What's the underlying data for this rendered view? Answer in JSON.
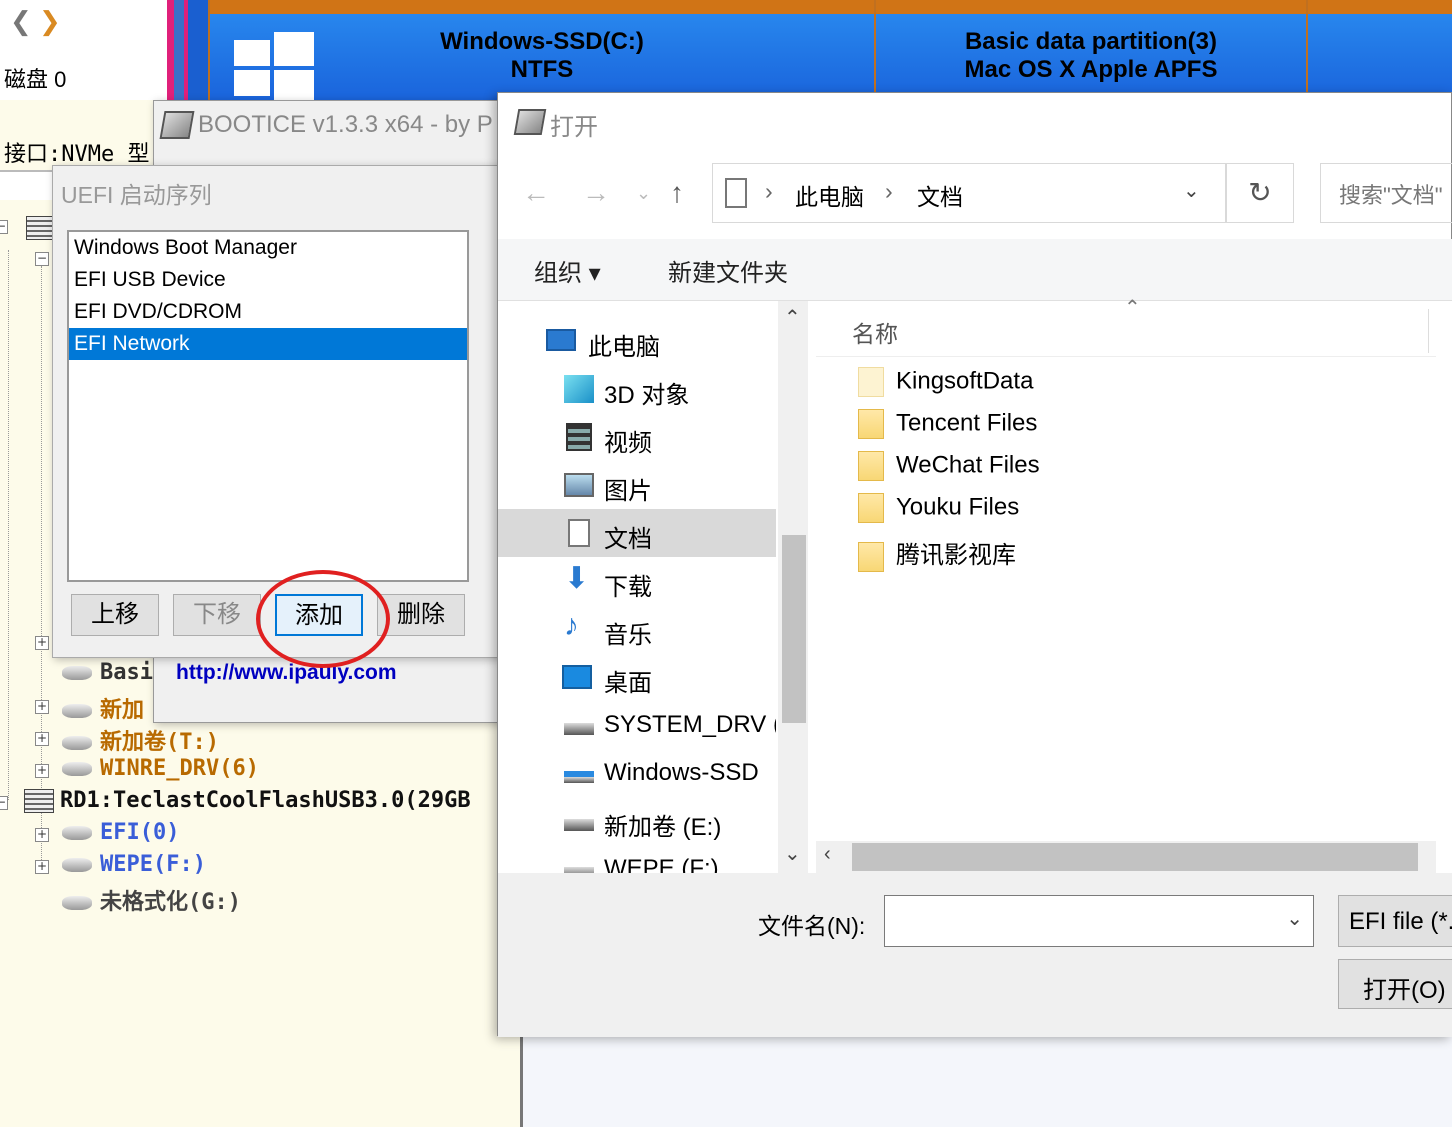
{
  "diskgenius": {
    "disk_label": "磁盘 0",
    "interface_label": "接口:NVMe  型",
    "partitions": [
      {
        "line1": "Windows-SSD(C:)",
        "line2": "NTFS"
      },
      {
        "line1": "Basic data partition(3)",
        "line2": "Mac OS X Apple APFS"
      }
    ],
    "tree": [
      {
        "label": "Basi",
        "color": "#333333"
      },
      {
        "label": "新加",
        "color": "#b86a00"
      },
      {
        "label": "新加卷(T:)",
        "color": "#b86a00"
      },
      {
        "label": "WINRE_DRV(6)",
        "color": "#b86a00"
      },
      {
        "label": "RD1:TeclastCoolFlashUSB3.0(29GB",
        "color": "#111111"
      },
      {
        "label": "EFI(0)",
        "color": "#3a5ed8"
      },
      {
        "label": "WEPE(F:)",
        "color": "#3a5ed8"
      },
      {
        "label": "未格式化(G:)",
        "color": "#444444"
      }
    ]
  },
  "bootice": {
    "title": "BOOTICE v1.3.3 x64 - by P",
    "url": "http://www.ipauly.com"
  },
  "uefi_dialog": {
    "title": "UEFI 启动序列",
    "entries": [
      "Windows Boot Manager",
      "EFI USB Device",
      "EFI DVD/CDROM",
      "EFI Network"
    ],
    "selected_index": 3,
    "buttons": {
      "up": "上移",
      "down": "下移",
      "add": "添加",
      "delete": "删除"
    }
  },
  "open_dialog": {
    "title": "打开",
    "breadcrumb": [
      "此电脑",
      "文档"
    ],
    "search_placeholder": "搜索\"文档\"",
    "toolbar": {
      "organize": "组织 ▾",
      "new_folder": "新建文件夹"
    },
    "nav_items": [
      {
        "label": "此电脑",
        "icon": "computer-icon"
      },
      {
        "label": "3D 对象",
        "icon": "cube-icon"
      },
      {
        "label": "视频",
        "icon": "video-icon"
      },
      {
        "label": "图片",
        "icon": "picture-icon"
      },
      {
        "label": "文档",
        "icon": "document-icon"
      },
      {
        "label": "下载",
        "icon": "download-icon"
      },
      {
        "label": "音乐",
        "icon": "music-icon"
      },
      {
        "label": "桌面",
        "icon": "desktop-icon"
      },
      {
        "label": "SYSTEM_DRV (",
        "icon": "drive-icon"
      },
      {
        "label": "Windows-SSD ",
        "icon": "windows-drive-icon"
      },
      {
        "label": "新加卷 (E:)",
        "icon": "drive-icon"
      },
      {
        "label": "WEPE (F:)",
        "icon": "drive-icon"
      }
    ],
    "column_name": "名称",
    "files": [
      "KingsoftData",
      "Tencent Files",
      "WeChat Files",
      "Youku Files",
      "腾讯影视库"
    ],
    "filename_label": "文件名(N):",
    "filename_value": "",
    "filetype_value": "EFI file (*.",
    "open_button": "打开(O)"
  }
}
